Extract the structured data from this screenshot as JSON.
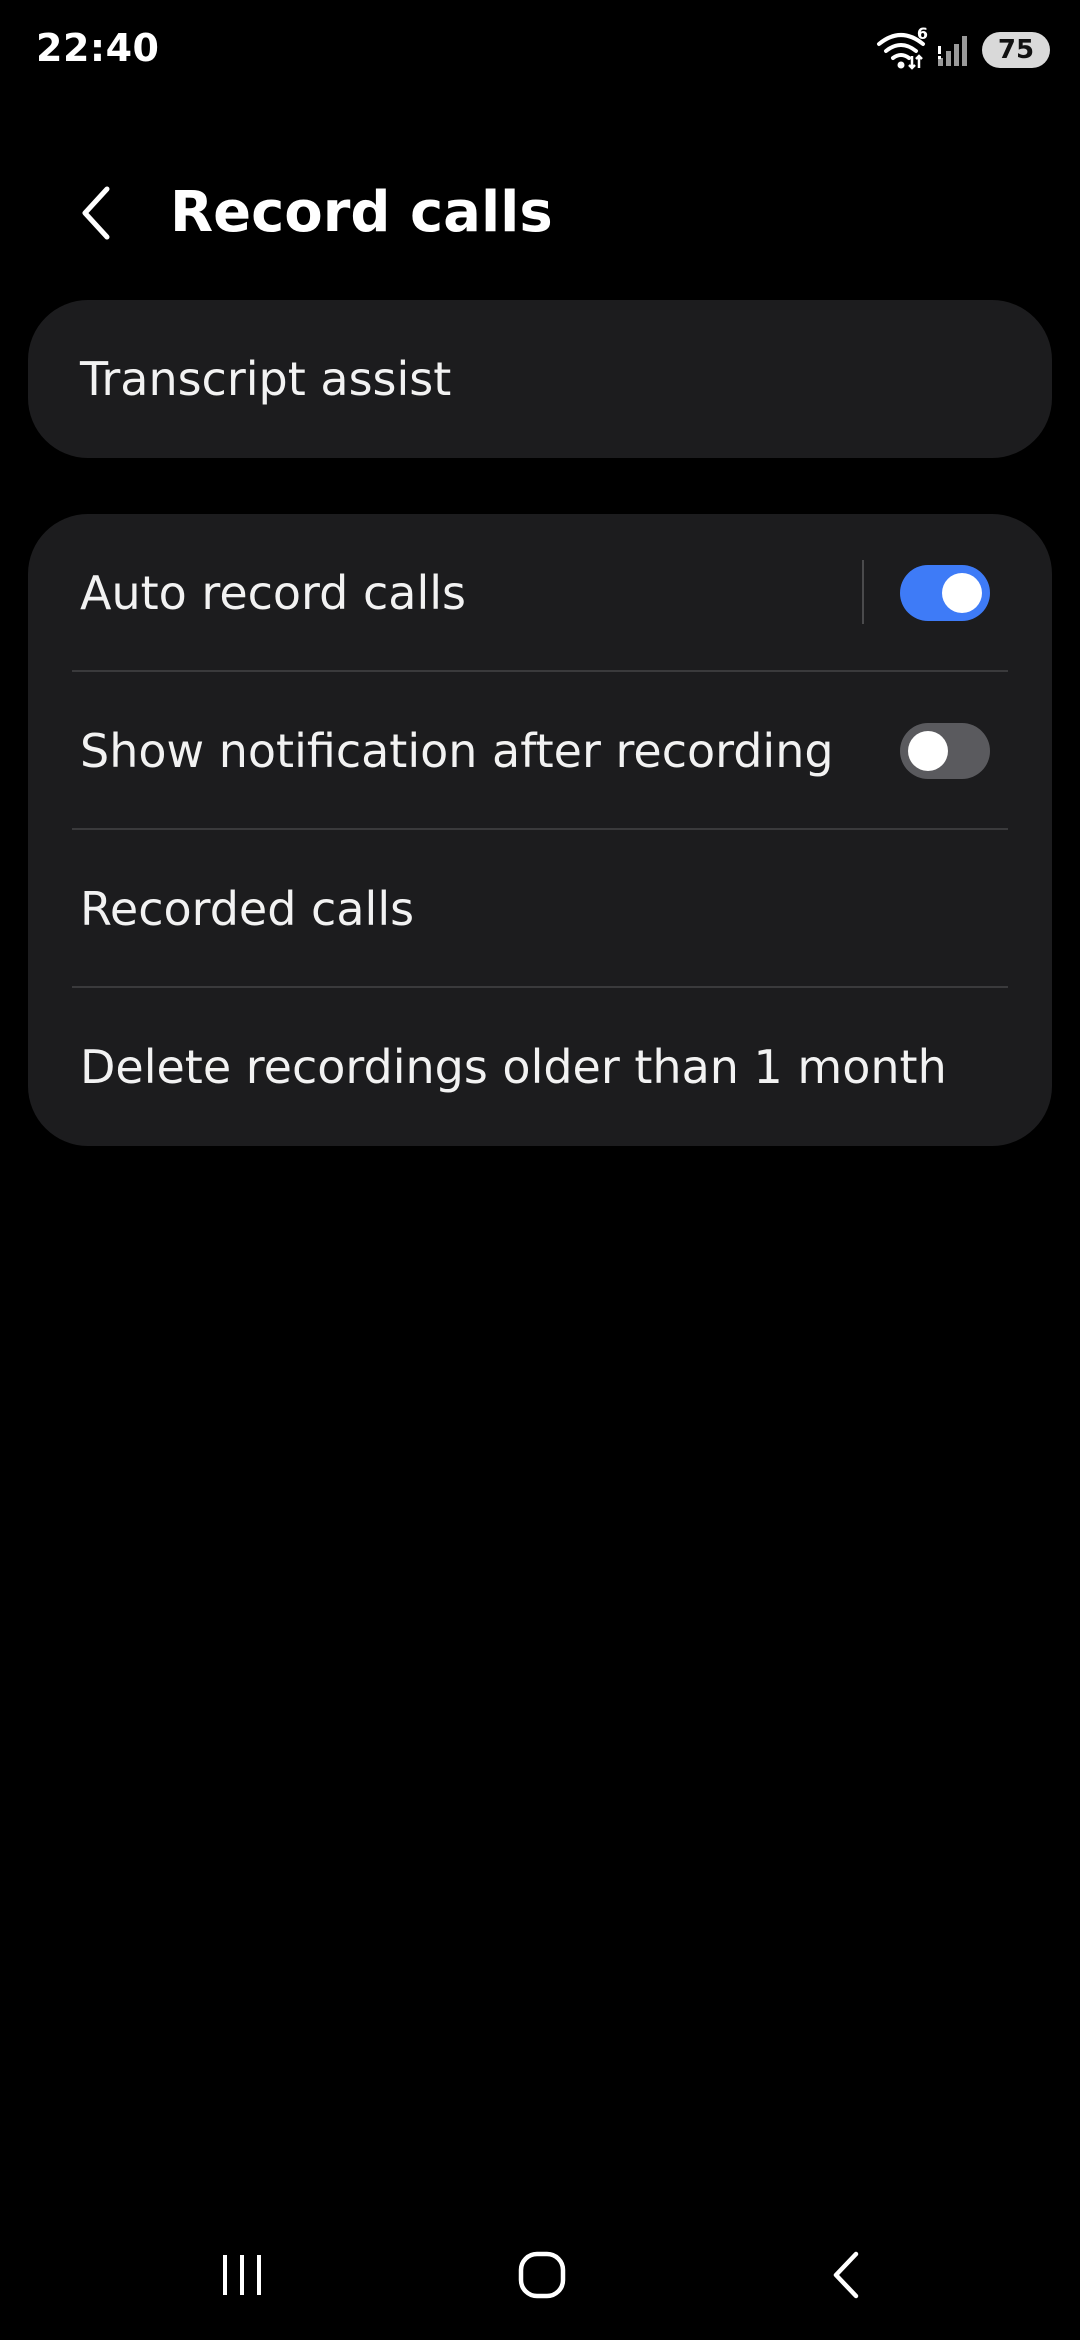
{
  "status_bar": {
    "time": "22:40",
    "wifi_badge": "6",
    "battery": "75"
  },
  "header": {
    "title": "Record calls"
  },
  "transcript_card": {
    "label": "Transcript assist"
  },
  "settings": {
    "auto_record": {
      "label": "Auto record calls",
      "enabled": true
    },
    "show_notification": {
      "label": "Show notification after recording",
      "enabled": false
    },
    "recorded_calls": {
      "label": "Recorded calls"
    },
    "delete_recordings": {
      "label": "Delete recordings older than 1 month"
    }
  },
  "colors": {
    "background": "#000000",
    "card": "#1c1c1e",
    "accent": "#3e7bf7",
    "toggle_off": "#5a5a5e"
  },
  "icons": {
    "back": "chevron-left-icon",
    "wifi": "wifi-icon",
    "signal": "signal-icon",
    "nav_recents": "recents-icon",
    "nav_home": "home-icon",
    "nav_back": "back-icon"
  }
}
